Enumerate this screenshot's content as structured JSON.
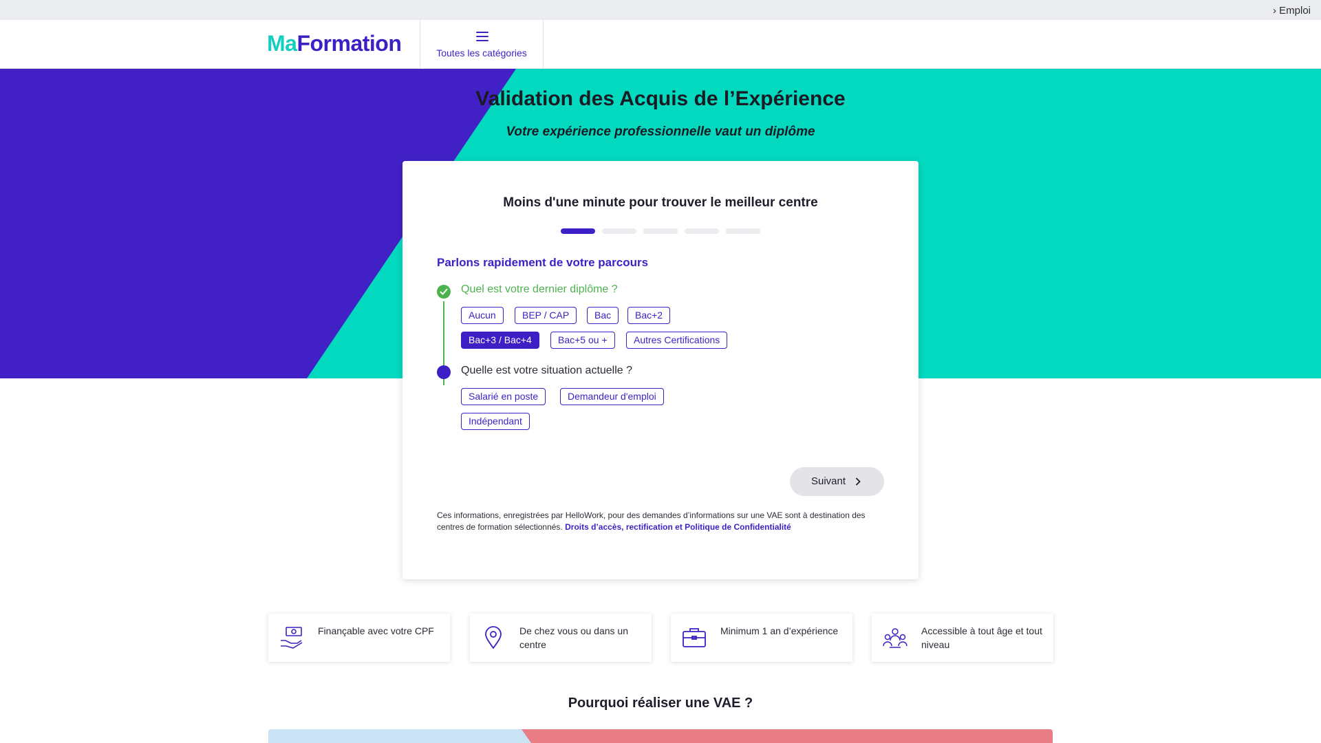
{
  "topbar": {
    "emploi_link": "› Emploi"
  },
  "header": {
    "logo": {
      "part1": "Ma",
      "part2": "Formation"
    },
    "categories_label": "Toutes les catégories"
  },
  "hero": {
    "title": "Validation des Acquis de l’Expérience",
    "subtitle": "Votre expérience professionnelle vaut un diplôme"
  },
  "card": {
    "title": "Moins d'une minute pour trouver le meilleur centre",
    "progress": {
      "current_step": 1,
      "total_steps": 5
    },
    "section_title": "Parlons rapidement de votre parcours",
    "question1": {
      "label": "Quel est votre dernier diplôme ?",
      "options": [
        "Aucun",
        "BEP / CAP",
        "Bac",
        "Bac+2",
        "Bac+3 / Bac+4",
        "Bac+5 ou +",
        "Autres Certifications"
      ],
      "selected": "Bac+3 / Bac+4"
    },
    "question2": {
      "label": "Quelle est votre situation actuelle ?",
      "options": [
        "Salarié en poste",
        "Demandeur d'emploi",
        "Indépendant"
      ]
    },
    "next_button": "Suivant",
    "legal_text": "Ces informations, enregistrées par HelloWork, pour des demandes d’informations sur une VAE sont à destination des centres de formation sélectionnés. ",
    "legal_link": "Droits d’accès, rectification et Politique de Confidentialité"
  },
  "features": [
    {
      "icon": "money-hand-icon",
      "text": "Finançable avec votre CPF"
    },
    {
      "icon": "location-pin-icon",
      "text": "De chez vous ou dans un centre"
    },
    {
      "icon": "briefcase-icon",
      "text": "Minimum 1 an d’expérience"
    },
    {
      "icon": "people-group-icon",
      "text": "Accessible à tout âge et tout niveau"
    }
  ],
  "why_title": "Pourquoi réaliser une VAE ?",
  "colors": {
    "brand_purple": "#3d1fc5",
    "brand_teal": "#02d9bf",
    "success_green": "#4cb24e"
  }
}
